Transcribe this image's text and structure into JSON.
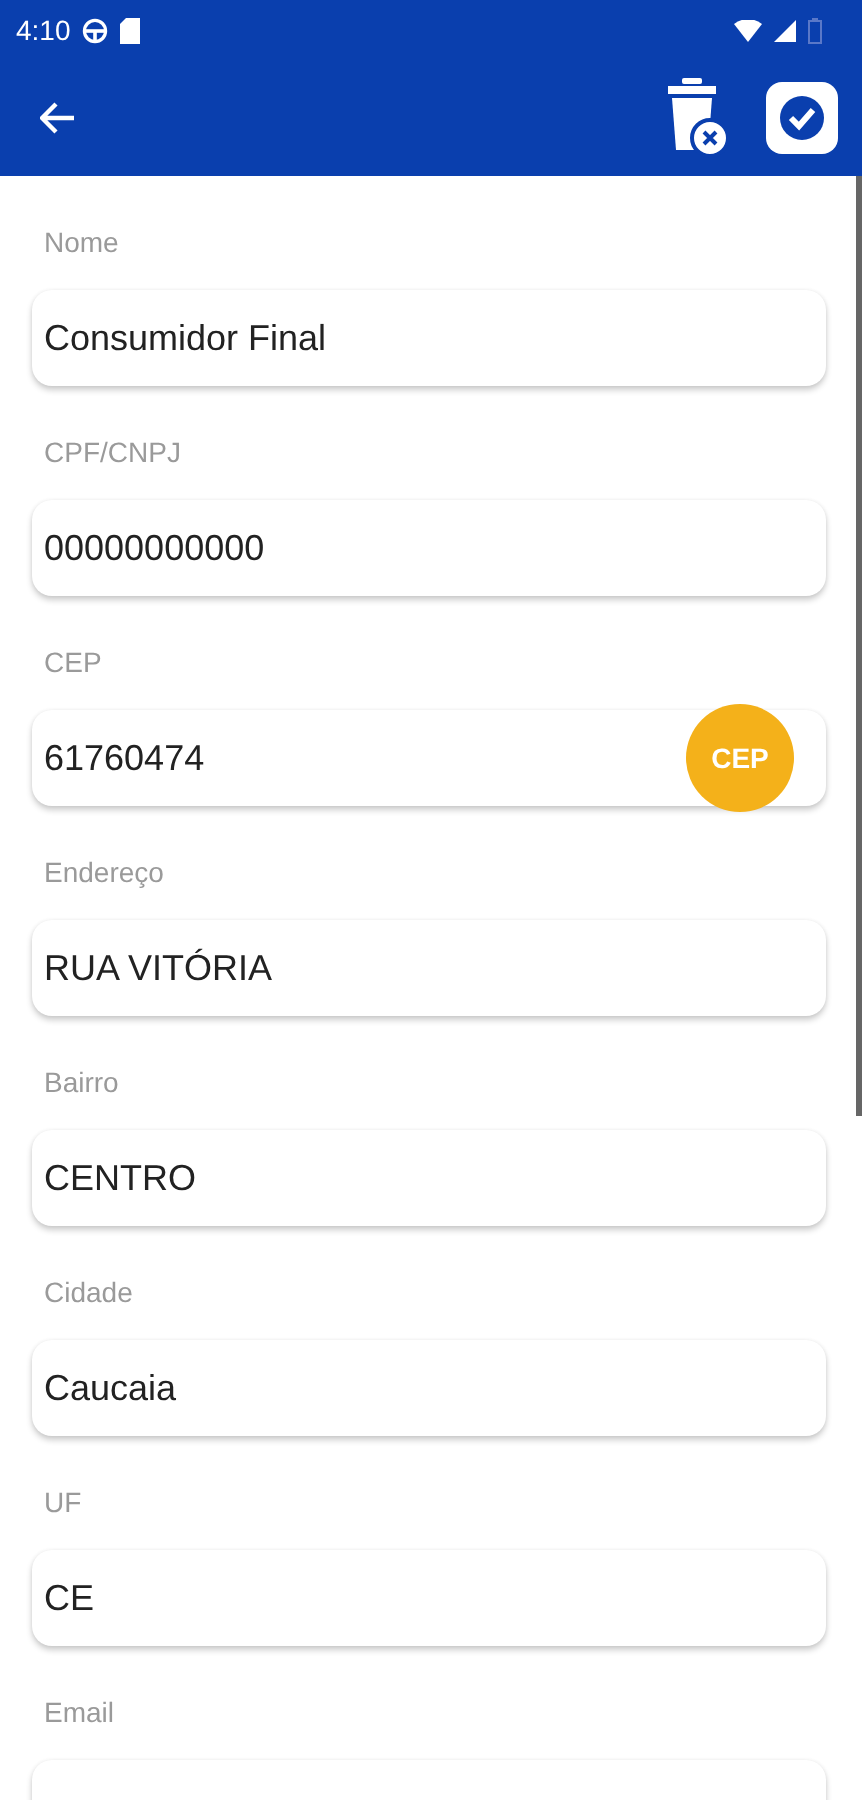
{
  "status_bar": {
    "time": "4:10"
  },
  "fields": [
    {
      "label": "Nome",
      "value": "Consumidor Final"
    },
    {
      "label": "CPF/CNPJ",
      "value": "00000000000"
    },
    {
      "label": "CEP",
      "value": "61760474",
      "button": "CEP"
    },
    {
      "label": "Endereço",
      "value": "RUA VITÓRIA"
    },
    {
      "label": "Bairro",
      "value": "CENTRO"
    },
    {
      "label": "Cidade",
      "value": "Caucaia"
    },
    {
      "label": "UF",
      "value": "CE"
    },
    {
      "label": "Email"
    }
  ]
}
